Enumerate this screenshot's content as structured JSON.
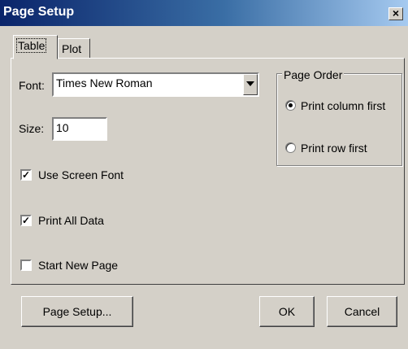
{
  "window": {
    "title": "Page Setup",
    "close_glyph": "×"
  },
  "tabs": [
    {
      "label": "Table",
      "active": true
    },
    {
      "label": "Plot",
      "active": false
    }
  ],
  "font": {
    "label": "Font:",
    "value": "Times New Roman"
  },
  "size": {
    "label": "Size:",
    "value": "10"
  },
  "options": {
    "use_screen_font": {
      "label": "Use Screen Font",
      "checked": true
    },
    "print_all_data": {
      "label": "Print All Data",
      "checked": true
    },
    "start_new_page": {
      "label": "Start New Page",
      "checked": false
    }
  },
  "page_order": {
    "title": "Page Order",
    "column_first": {
      "label": "Print column first",
      "selected": true
    },
    "row_first": {
      "label": "Print row first",
      "selected": false
    }
  },
  "buttons": {
    "page_setup": "Page Setup...",
    "ok": "OK",
    "cancel": "Cancel"
  },
  "icons": {
    "close": "close-icon",
    "dropdown": "chevron-down-icon",
    "check": "✓"
  }
}
